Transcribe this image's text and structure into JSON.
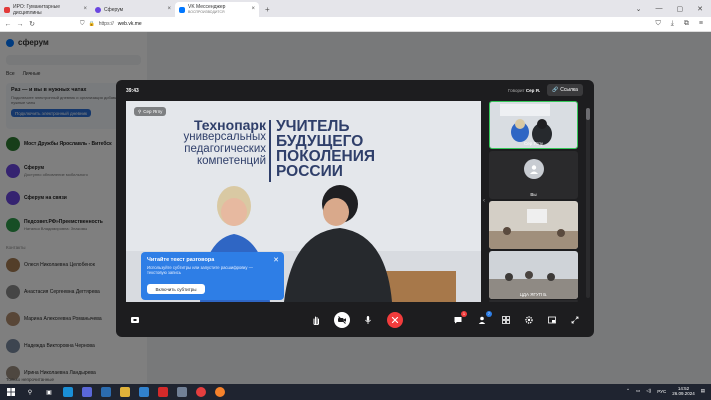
{
  "browser": {
    "tabs": [
      {
        "label": "ИРО: Гуманитарные дисциплины",
        "color": "#e23a3a"
      },
      {
        "label": "Сферум",
        "color": "#6a46e0"
      },
      {
        "label": "VK Мессенджер",
        "sublabel": "ВОСПРОИЗВОДИТСЯ",
        "color": "#0077ff"
      }
    ],
    "address": {
      "prefix": "https://",
      "host": "web.vk.me"
    }
  },
  "sidebar": {
    "app_name": "сферум",
    "filters": [
      "Все",
      "Личные"
    ],
    "promo": {
      "title": "Раз — и вы в нужных чатах",
      "text": "Подключите электронный дневник и организация добавит вас в нужные чаты",
      "button": "Подключить электронный дневник"
    },
    "chats": [
      {
        "name": "Мост Дружбы Ярославль - Витебск",
        "msg": "",
        "color": "#2e7d32"
      },
      {
        "name": "Сферум",
        "msg": "Доступно обновление мобильного",
        "color": "#6a46e0"
      },
      {
        "name": "Сферум на связи",
        "msg": "",
        "color": "#6a46e0"
      },
      {
        "name": "Педсовет.РФ»Преемственность",
        "msg": "Наталья Владимировна: Знакомы",
        "color": "#2e9d4a"
      }
    ],
    "contacts_title": "Контакты",
    "contacts": [
      {
        "name": "Олеся Николаевна Целобенок",
        "msg": "",
        "color": "#a67c52"
      },
      {
        "name": "Анастасия Сергеевна Дегтярева",
        "msg": "",
        "color": "#8a8a8a"
      },
      {
        "name": "Марина Алексеевна Романычева",
        "msg": "",
        "color": "#b08d6e"
      },
      {
        "name": "Надежда Викторовна Чернова",
        "msg": "",
        "color": "#7a8aa0"
      },
      {
        "name": "Ирина Николаевна Ландырева",
        "msg": "",
        "color": "#9c8f80"
      }
    ],
    "bottom_label": "Только непрочитанные"
  },
  "call": {
    "timer": "39:43",
    "speaking_label": "Говорит",
    "speaking_name": "Сер Я.",
    "link_label": "Ссылка",
    "main_badge": "Сер Ягпу",
    "wall_left": [
      "Технопарк",
      "универсальных",
      "педагогических",
      "компетенций"
    ],
    "wall_right": [
      "УЧИТЕЛЬ",
      "БУДУЩЕГО",
      "ПОКОЛЕНИЯ",
      "РОССИИ"
    ],
    "thumb_labels": [
      "Сер Ягпу",
      "Вы",
      "",
      "ЦДА ЯГУП Б.",
      ""
    ],
    "subtitle_hint": {
      "title": "Читайте текст разговора",
      "text": "Используйте субтитры или запустите расшифровку — текстовую запись",
      "button": "Включить субтитры"
    },
    "chat_badge": "1",
    "participants_badge": "7",
    "colors": {
      "end_call": "#f23c3c",
      "active_border": "#35c759",
      "hint_bg": "#2e7ee6"
    }
  },
  "taskbar": {
    "lang": "РУС",
    "time": "14:52",
    "date": "26.09.2024"
  }
}
